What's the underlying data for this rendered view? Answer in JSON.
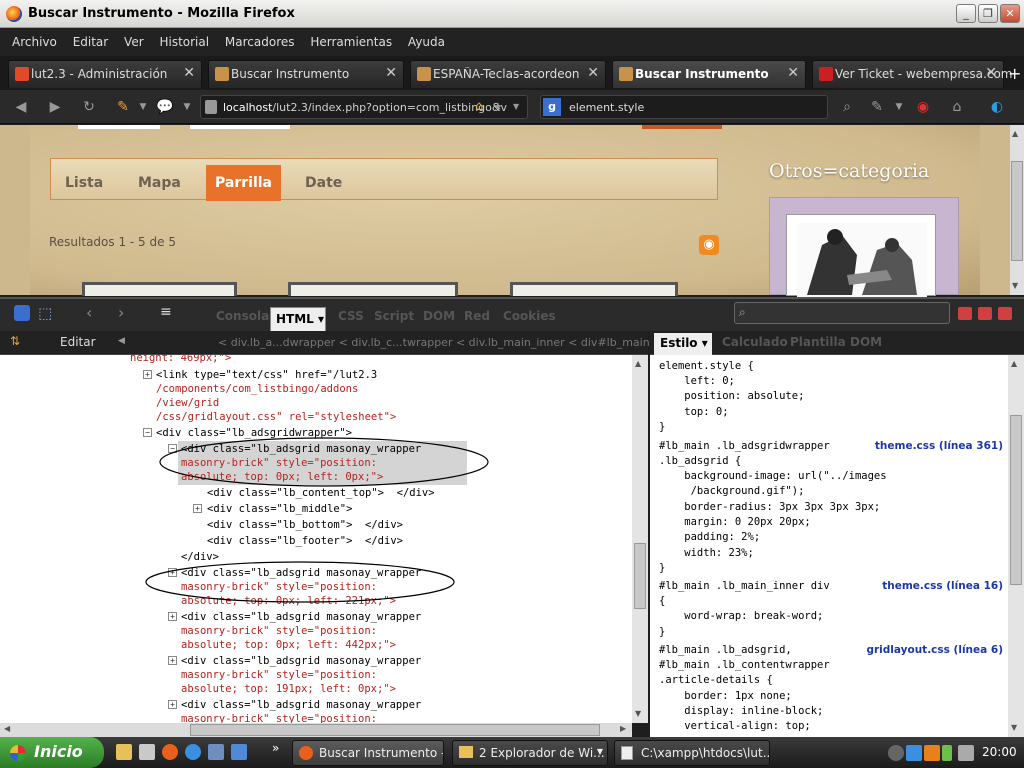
{
  "window": {
    "title": "Buscar Instrumento - Mozilla Firefox"
  },
  "menu": [
    "Archivo",
    "Editar",
    "Ver",
    "Historial",
    "Marcadores",
    "Herramientas",
    "Ayuda"
  ],
  "browser_tabs": [
    {
      "label": "lut2.3 - Administración",
      "icon_color": "#e04a2a"
    },
    {
      "label": "Buscar Instrumento",
      "icon_color": "#c8924a"
    },
    {
      "label": "ESPAÑA-Teclas-acordeon",
      "icon_color": "#c8924a"
    },
    {
      "label": "Buscar Instrumento",
      "icon_color": "#c8924a",
      "active": true
    },
    {
      "label": "Ver Ticket - webempresa.com",
      "icon_color": "#cc1f1f"
    }
  ],
  "navbar": {
    "url_host": "localhost",
    "url_path": "/lut2.3/index.php?option=com_listbingo&v",
    "search_value": "element.style"
  },
  "page": {
    "view_tabs": [
      "Lista",
      "Mapa",
      "Parrilla",
      "Date"
    ],
    "active_view": "Parrilla",
    "results": "Resultados 1 - 5 de 5",
    "sidebar_heading": "Otros=categoria"
  },
  "firebug": {
    "tabs": [
      "Consola",
      "HTML",
      "CSS",
      "Script",
      "DOM",
      "Red",
      "Cookies"
    ],
    "active_tab": "HTML",
    "edit_label": "Editar",
    "breadcrumbs": "< div.lb_a...dwrapper  < div.lb_c...twrapper  < div.lb_main_inner  < div#lb_main  < d",
    "side_tabs": [
      "Estilo",
      "Calculado",
      "Plantilla",
      "DOM"
    ],
    "active_side_tab": "Estilo",
    "html_lines": [
      {
        "text": "height: 469px;\">"
      },
      {
        "text": "<link type=\"text/css\" href=\"/lut2.3"
      },
      {
        "text": "/components/com_listbingo/addons"
      },
      {
        "text": "/view/grid"
      },
      {
        "text": "/css/gridlayout.css\" rel=\"stylesheet\">"
      },
      {
        "text": "<div class=\"lb_adsgridwrapper\">"
      },
      {
        "text": "<div class=\"lb_adsgrid masonay_wrapper"
      },
      {
        "text": "masonry-brick\" style=\"position:"
      },
      {
        "text": "absolute; top: 0px; left: 0px;\">"
      },
      {
        "text": "<div class=\"lb_content_top\">  </div>"
      },
      {
        "text": "<div class=\"lb_middle\">"
      },
      {
        "text": "<div class=\"lb_bottom\">  </div>"
      },
      {
        "text": "<div class=\"lb_footer\">  </div>"
      },
      {
        "text": "</div>"
      },
      {
        "text": "<div class=\"lb_adsgrid masonay_wrapper"
      },
      {
        "text": "masonry-brick\" style=\"position:"
      },
      {
        "text": "absolute; top: 0px; left: 221px;\">"
      },
      {
        "text": "<div class=\"lb_adsgrid masonay_wrapper"
      },
      {
        "text": "masonry-brick\" style=\"position:"
      },
      {
        "text": "absolute; top: 0px; left: 442px;\">"
      },
      {
        "text": "<div class=\"lb_adsgrid masonay_wrapper"
      },
      {
        "text": "masonry-brick\" style=\"position:"
      },
      {
        "text": "absolute; top: 191px; left: 0px;\">"
      },
      {
        "text": "<div class=\"lb_adsgrid masonay_wrapper"
      },
      {
        "text": "masonry-brick\" style=\"position:"
      }
    ],
    "style_lines": [
      {
        "text": "element.style {"
      },
      {
        "text": "    left: 0;"
      },
      {
        "text": "    position: absolute;"
      },
      {
        "text": "    top: 0;"
      },
      {
        "text": "}"
      },
      {
        "text": "#lb_main .lb_adsgridwrapper",
        "source": "theme.css (línea 361)"
      },
      {
        "text": ".lb_adsgrid {"
      },
      {
        "text": "    background-image: url(\"../images"
      },
      {
        "text": "     /background.gif\");"
      },
      {
        "text": "    border-radius: 3px 3px 3px 3px;"
      },
      {
        "text": "    margin: 0 20px 20px;"
      },
      {
        "text": "    padding: 2%;"
      },
      {
        "text": "    width: 23%;"
      },
      {
        "text": "}"
      },
      {
        "text": "#lb_main .lb_main_inner div",
        "source": "theme.css (línea 16)"
      },
      {
        "text": "{"
      },
      {
        "text": "    word-wrap: break-word;"
      },
      {
        "text": "}"
      },
      {
        "text": "#lb_main .lb_adsgrid,",
        "source": "gridlayout.css (línea 6)"
      },
      {
        "text": "#lb_main .lb_contentwrapper"
      },
      {
        "text": ".article-details {"
      },
      {
        "text": "    border: 1px none;"
      },
      {
        "text": "    display: inline-block;"
      },
      {
        "text": "    vertical-align: top;"
      }
    ]
  },
  "taskbar": {
    "start": "Inicio",
    "tasks": [
      {
        "label": "Buscar Instrumento - ..."
      },
      {
        "label": "2 Explorador de Wi..."
      },
      {
        "label": "C:\\xampp\\htdocs\\lut..."
      }
    ],
    "clock": "20:00"
  }
}
